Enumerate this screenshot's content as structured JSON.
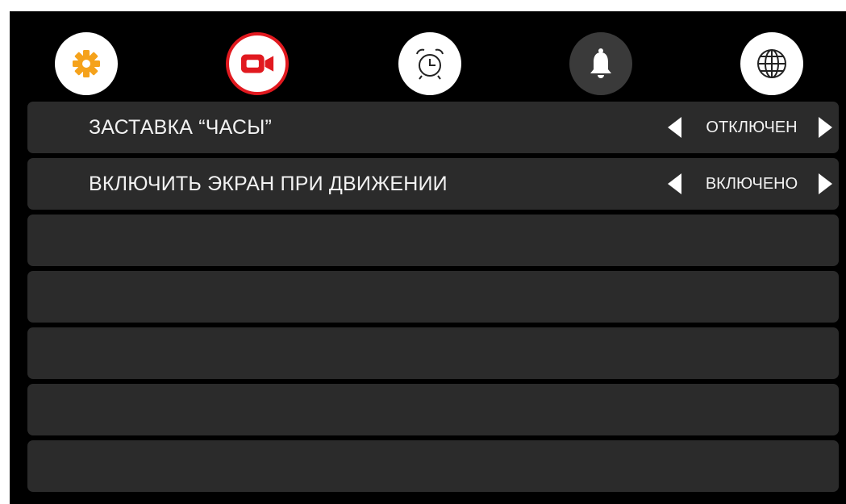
{
  "tabs": [
    {
      "icon": "gear-icon",
      "state": "inactive"
    },
    {
      "icon": "video-camera-icon",
      "state": "active"
    },
    {
      "icon": "alarm-clock-icon",
      "state": "inactive"
    },
    {
      "icon": "bell-icon",
      "state": "inactive-dark"
    },
    {
      "icon": "globe-icon",
      "state": "inactive"
    }
  ],
  "colors": {
    "accent": "#e1191f",
    "gear": "#f5a21b",
    "row_bg": "#2b2b2b",
    "screen_bg": "#000000"
  },
  "settings": [
    {
      "label": "ЗАСТАВКА “ЧАСЫ”",
      "value": "ОТКЛЮЧЕН"
    },
    {
      "label": "ВКЛЮЧИТЬ ЭКРАН ПРИ ДВИЖЕНИИ",
      "value": "ВКЛЮЧЕНО"
    }
  ]
}
